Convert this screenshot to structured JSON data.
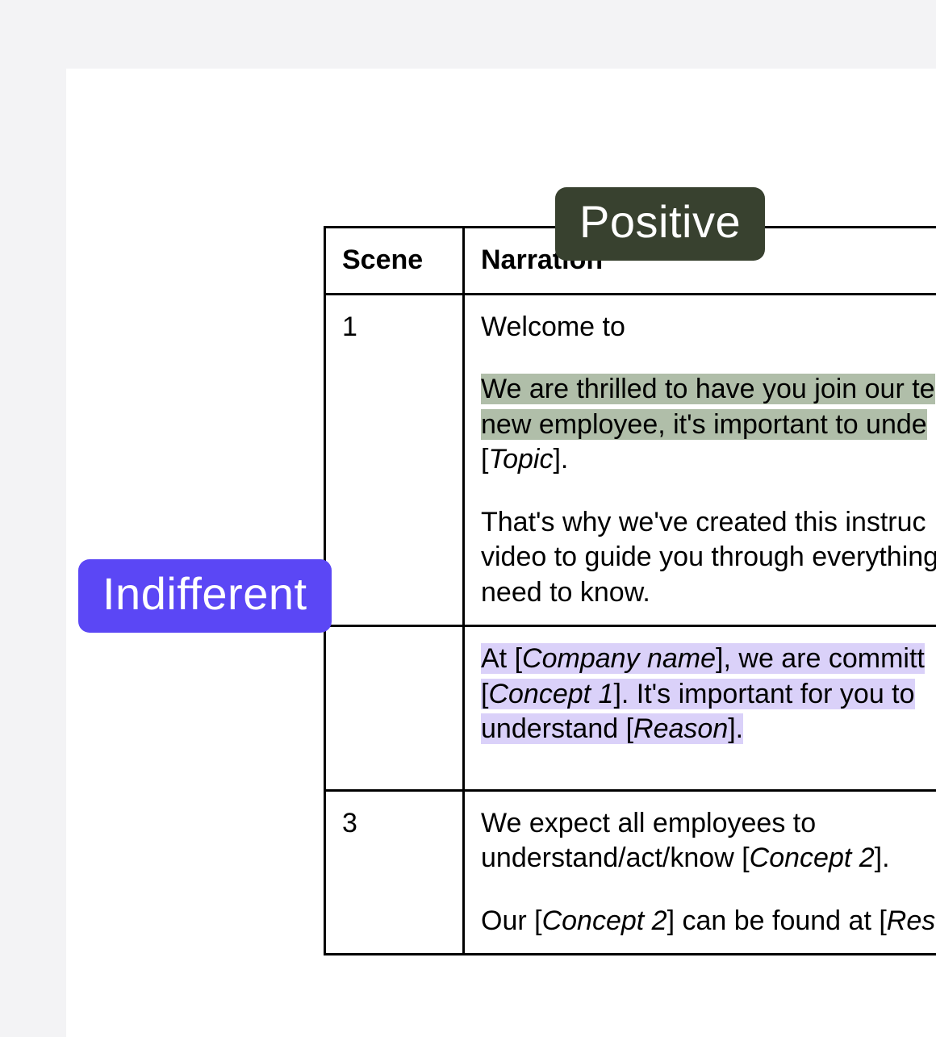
{
  "table": {
    "headers": {
      "scene": "Scene",
      "narration": "Narration"
    },
    "rows": [
      {
        "scene": "1",
        "line1_a": "Welcome to ",
        "line2_a": "We are thrilled to have you join our te",
        "line2_b": "new employee, it's important to unde",
        "line2_c_open": "[",
        "line2_c_topic": "Topic",
        "line2_c_close": "].",
        "line3_a": "That's why we've created this instruc",
        "line3_b": "video to guide you through everything",
        "line3_c": "need to know."
      },
      {
        "scene": "",
        "line1_a": "At [",
        "line1_company": "Company name",
        "line1_b": "], we are committ",
        "line2_a": "[",
        "line2_concept": "Concept 1",
        "line2_b": "]. It's important for you to ",
        "line3_a": "understand [",
        "line3_reason": "Reason",
        "line3_b": "]."
      },
      {
        "scene": "3",
        "line1_a": "We expect all employees to",
        "line2_a": "understand/act/know [",
        "line2_concept": "Concept 2",
        "line2_b": "].",
        "line3_a": "Our [",
        "line3_concept": "Concept 2",
        "line3_b": "] can be found at [",
        "line3_res": "Res"
      }
    ]
  },
  "tags": {
    "positive": "Positive",
    "indifferent": "Indifferent"
  }
}
